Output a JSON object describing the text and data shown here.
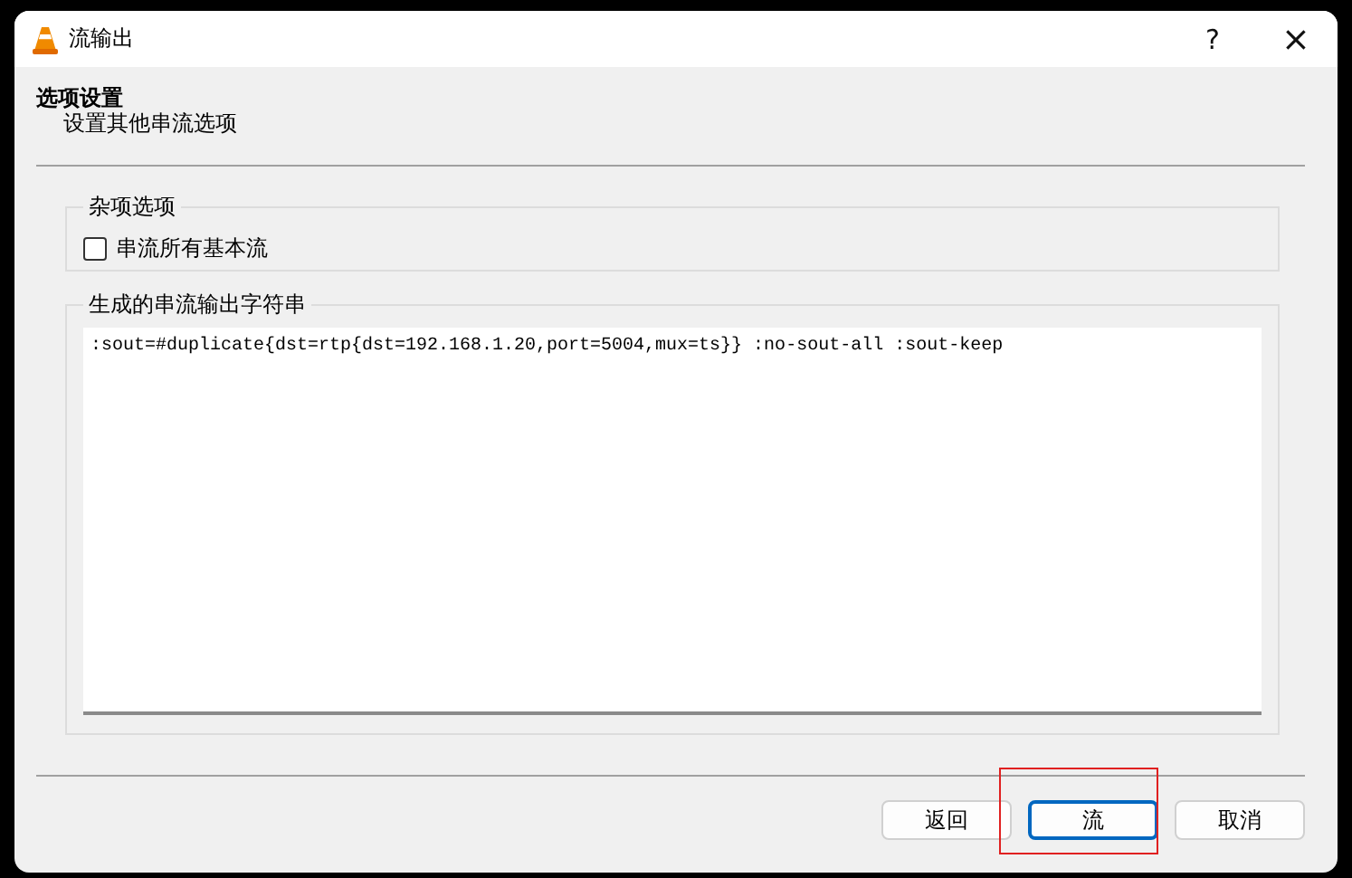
{
  "window": {
    "title": "流输出",
    "help": "?",
    "close": "×"
  },
  "header": {
    "title": "选项设置",
    "subtitle": "设置其他串流选项"
  },
  "misc_group": {
    "title": "杂项选项",
    "checkbox": {
      "label": "串流所有基本流",
      "checked": false
    }
  },
  "output_group": {
    "title": "生成的串流输出字符串",
    "value": ":sout=#duplicate{dst=rtp{dst=192.168.1.20,port=5004,mux=ts}} :no-sout-all :sout-keep"
  },
  "buttons": [
    {
      "label": "返回",
      "focused": false,
      "highlighted": false
    },
    {
      "label": "流",
      "focused": true,
      "highlighted": true
    },
    {
      "label": "取消",
      "focused": false,
      "highlighted": false
    }
  ]
}
